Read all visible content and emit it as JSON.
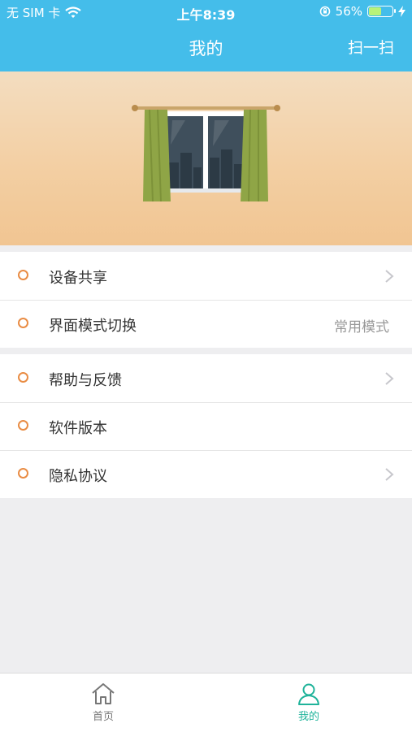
{
  "status_bar": {
    "carrier": "无 SIM 卡",
    "time": "上午8:39",
    "battery_percent": "56%",
    "battery_level": 0.56
  },
  "nav": {
    "title": "我的",
    "right_action": "扫一扫"
  },
  "menu": {
    "group1": [
      {
        "label": "设备共享",
        "value": "",
        "chevron": true
      },
      {
        "label": "界面模式切换",
        "value": "常用模式",
        "chevron": false
      }
    ],
    "group2": [
      {
        "label": "帮助与反馈",
        "chevron": true
      },
      {
        "label": "软件版本",
        "chevron": false
      },
      {
        "label": "隐私协议",
        "chevron": true
      }
    ]
  },
  "tabbar": {
    "home": "首页",
    "mine": "我的"
  },
  "colors": {
    "header": "#44bdea",
    "accent_active": "#1fb39a",
    "bullet": "#e98c44"
  }
}
